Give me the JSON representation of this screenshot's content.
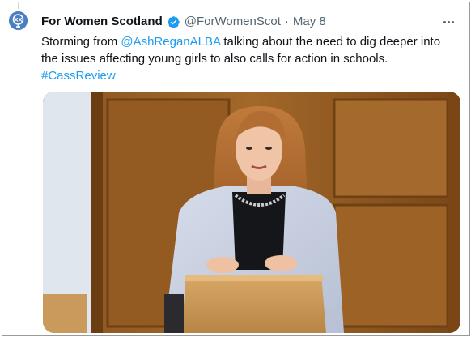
{
  "tweet": {
    "author": {
      "display_name": "For Women Scotland",
      "handle": "@ForWomenScot",
      "verified": true,
      "avatar_icon": "avatar-logo-icon"
    },
    "separator": "·",
    "date": "May 8",
    "text_parts": {
      "intro": "Storming from ",
      "mention": "@AshReganALBA",
      "body": " talking about the need to dig deeper into the issues affecting young girls to also calls for action in schools.",
      "hashtag": "#CassReview"
    },
    "more_icon": "more-options-icon"
  },
  "colors": {
    "link": "#1d9bf0",
    "verified": "#1d9bf0",
    "text": "#0f1419",
    "secondary": "#536471"
  }
}
